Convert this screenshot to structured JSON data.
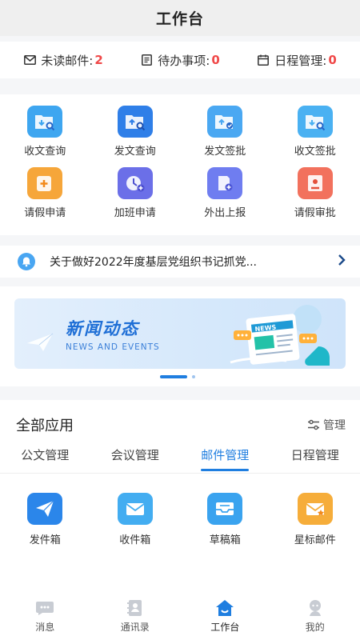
{
  "header": {
    "title": "工作台"
  },
  "stats": [
    {
      "icon": "mail-icon",
      "label": "未读邮件:",
      "count": "2"
    },
    {
      "icon": "list-icon",
      "label": "待办事项:",
      "count": "0"
    },
    {
      "icon": "calendar-icon",
      "label": "日程管理:",
      "count": "0"
    }
  ],
  "quick_actions": [
    {
      "label": "收文查询",
      "icon": "folder-search-icon",
      "color": "#3ea6f0"
    },
    {
      "label": "发文查询",
      "icon": "folder-upload-search-icon",
      "color": "#2f7fe8"
    },
    {
      "label": "发文签批",
      "icon": "folder-sign-icon",
      "color": "#4aa8f2"
    },
    {
      "label": "收文签批",
      "icon": "folder-review-icon",
      "color": "#4ab1f2"
    },
    {
      "label": "请假申请",
      "icon": "leave-apply-icon",
      "color": "#f6a63a"
    },
    {
      "label": "加班申请",
      "icon": "overtime-clock-icon",
      "color": "#6b6fe8"
    },
    {
      "label": "外出上报",
      "icon": "outing-report-icon",
      "color": "#6f7df0"
    },
    {
      "label": "请假审批",
      "icon": "leave-approve-icon",
      "color": "#f2715d"
    }
  ],
  "notice": {
    "text": "关于做好2022年度基层党组织书记抓党..."
  },
  "banner": {
    "title": "新闻动态",
    "subtitle": "NEWS AND EVENTS",
    "image_text": "NEWS"
  },
  "apps": {
    "title": "全部应用",
    "manage_label": "管理",
    "tabs": [
      "公文管理",
      "会议管理",
      "邮件管理",
      "日程管理"
    ],
    "active_tab": 2,
    "items": [
      {
        "label": "发件箱",
        "icon": "paper-plane-icon",
        "color": "#2b86ea"
      },
      {
        "label": "收件箱",
        "icon": "inbox-icon",
        "color": "#43adf1"
      },
      {
        "label": "草稿箱",
        "icon": "drafts-icon",
        "color": "#3aa3ef"
      },
      {
        "label": "星标邮件",
        "icon": "star-mail-icon",
        "color": "#f6ad3a"
      }
    ]
  },
  "tabbar": [
    {
      "label": "消息",
      "icon": "chat-icon"
    },
    {
      "label": "通讯录",
      "icon": "contacts-icon"
    },
    {
      "label": "工作台",
      "icon": "home-icon"
    },
    {
      "label": "我的",
      "icon": "profile-icon"
    }
  ],
  "active_tabbar": 2,
  "colors": {
    "accent": "#1f7ee0",
    "badge": "#f04848"
  }
}
